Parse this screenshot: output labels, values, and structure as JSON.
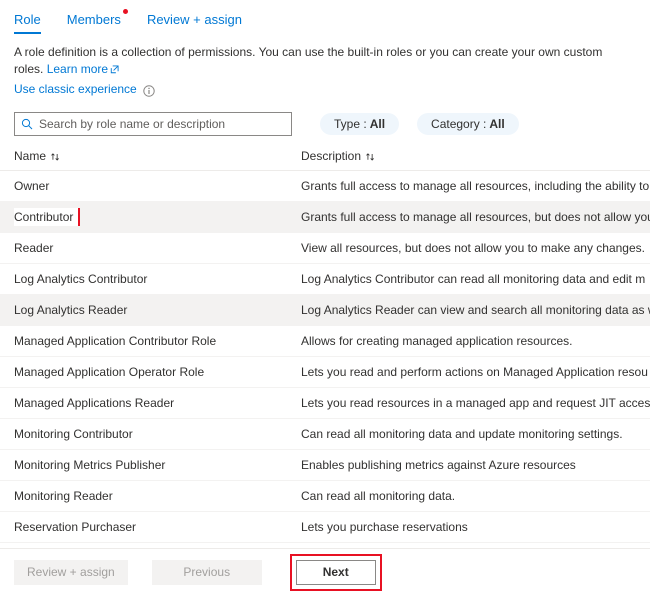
{
  "tabs": [
    {
      "label": "Role",
      "selected": true,
      "badge": false
    },
    {
      "label": "Members",
      "selected": false,
      "badge": true
    },
    {
      "label": "Review + assign",
      "selected": false,
      "badge": false
    }
  ],
  "intro": {
    "text": "A role definition is a collection of permissions. You can use the built-in roles or you can create your own custom roles.",
    "learn_more": "Learn more",
    "learn_more_icon": "external-link-icon",
    "classic_link": "Use classic experience",
    "info_icon": "info-icon"
  },
  "search": {
    "placeholder": "Search by role name or description",
    "value": "",
    "icon": "search-icon"
  },
  "filters": [
    {
      "label": "Type :",
      "value": "All",
      "name": "type-filter"
    },
    {
      "label": "Category :",
      "value": "All",
      "name": "category-filter"
    }
  ],
  "table": {
    "columns": [
      {
        "label": "Name",
        "sort_icon": "sort-updown-icon"
      },
      {
        "label": "Description",
        "sort_icon": "sort-updown-icon"
      }
    ],
    "rows": [
      {
        "name": "Owner",
        "description": "Grants full access to manage all resources, including the ability to",
        "shaded": false,
        "highlighted": false
      },
      {
        "name": "Contributor",
        "description": "Grants full access to manage all resources, but does not allow you",
        "shaded": true,
        "highlighted": true
      },
      {
        "name": "Reader",
        "description": "View all resources, but does not allow you to make any changes.",
        "shaded": false,
        "highlighted": false
      },
      {
        "name": "Log Analytics Contributor",
        "description": "Log Analytics Contributor can read all monitoring data and edit m",
        "shaded": false,
        "highlighted": false
      },
      {
        "name": "Log Analytics Reader",
        "description": "Log Analytics Reader can view and search all monitoring data as w",
        "shaded": true,
        "highlighted": false
      },
      {
        "name": "Managed Application Contributor Role",
        "description": "Allows for creating managed application resources.",
        "shaded": false,
        "highlighted": false
      },
      {
        "name": "Managed Application Operator Role",
        "description": "Lets you read and perform actions on Managed Application resou",
        "shaded": false,
        "highlighted": false
      },
      {
        "name": "Managed Applications Reader",
        "description": "Lets you read resources in a managed app and request JIT access",
        "shaded": false,
        "highlighted": false
      },
      {
        "name": "Monitoring Contributor",
        "description": "Can read all monitoring data and update monitoring settings.",
        "shaded": false,
        "highlighted": false
      },
      {
        "name": "Monitoring Metrics Publisher",
        "description": "Enables publishing metrics against Azure resources",
        "shaded": false,
        "highlighted": false
      },
      {
        "name": "Monitoring Reader",
        "description": "Can read all monitoring data.",
        "shaded": false,
        "highlighted": false
      },
      {
        "name": "Reservation Purchaser",
        "description": "Lets you purchase reservations",
        "shaded": false,
        "highlighted": false
      }
    ]
  },
  "footer": {
    "review_assign": "Review + assign",
    "previous": "Previous",
    "next": "Next",
    "next_highlighted": true
  },
  "colors": {
    "accent": "#0078d4",
    "annotation": "#e81123",
    "row_shade": "#f3f2f1",
    "pill_bg": "#eff6fc"
  }
}
